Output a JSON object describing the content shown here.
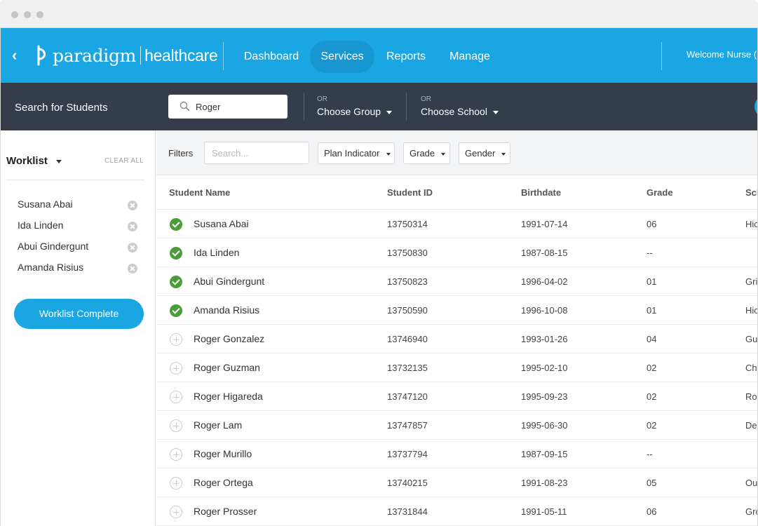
{
  "nav": {
    "brand_primary": "paradigm",
    "brand_secondary": "healthcare",
    "items": [
      {
        "label": "Dashboard",
        "active": false
      },
      {
        "label": "Services",
        "active": true
      },
      {
        "label": "Reports",
        "active": false
      },
      {
        "label": "Manage",
        "active": false
      }
    ],
    "welcome": "Welcome Nurse (N",
    "accent_color": "#1aa6e3"
  },
  "searchbar": {
    "label": "Search for Students",
    "query": "Roger",
    "group": {
      "or": "OR",
      "label": "Choose Group"
    },
    "school": {
      "or": "OR",
      "label": "Choose School"
    }
  },
  "worklist": {
    "title": "Worklist",
    "clear_all": "CLEAR ALL",
    "items": [
      "Susana Abai",
      "Ida Linden",
      "Abui Gindergunt",
      "Amanda Risius"
    ],
    "complete_button": "Worklist Complete"
  },
  "filters": {
    "label": "Filters",
    "search_placeholder": "Search...",
    "dropdowns": [
      "Plan Indicator",
      "Grade",
      "Gender"
    ]
  },
  "table": {
    "columns": [
      "Student Name",
      "Student ID",
      "Birthdate",
      "Grade",
      "Sch"
    ],
    "rows": [
      {
        "name": "Susana Abai",
        "id": "13750314",
        "birthdate": "1991-07-14",
        "grade": "06",
        "school": "Hic",
        "selected": true
      },
      {
        "name": "Ida Linden",
        "id": "13750830",
        "birthdate": "1987-08-15",
        "grade": "--",
        "school": "",
        "selected": true
      },
      {
        "name": "Abui Gindergunt",
        "id": "13750823",
        "birthdate": "1996-04-02",
        "grade": "01",
        "school": "Gri",
        "selected": true
      },
      {
        "name": "Amanda Risius",
        "id": "13750590",
        "birthdate": "1996-10-08",
        "grade": "01",
        "school": "Hic",
        "selected": true
      },
      {
        "name": "Roger Gonzalez",
        "id": "13746940",
        "birthdate": "1993-01-26",
        "grade": "04",
        "school": "Gul",
        "selected": false
      },
      {
        "name": "Roger Guzman",
        "id": "13732135",
        "birthdate": "1995-02-10",
        "grade": "02",
        "school": "Che",
        "selected": false
      },
      {
        "name": "Roger Higareda",
        "id": "13747120",
        "birthdate": "1995-09-23",
        "grade": "02",
        "school": "Ros",
        "selected": false
      },
      {
        "name": "Roger Lam",
        "id": "13747857",
        "birthdate": "1995-06-30",
        "grade": "02",
        "school": "Del",
        "selected": false
      },
      {
        "name": "Roger Murillo",
        "id": "13737794",
        "birthdate": "1987-09-15",
        "grade": "--",
        "school": "",
        "selected": false
      },
      {
        "name": "Roger Ortega",
        "id": "13740215",
        "birthdate": "1991-08-23",
        "grade": "05",
        "school": "Ou",
        "selected": false
      },
      {
        "name": "Roger Prosser",
        "id": "13731844",
        "birthdate": "1991-05-11",
        "grade": "06",
        "school": "Gro",
        "selected": false
      }
    ]
  }
}
